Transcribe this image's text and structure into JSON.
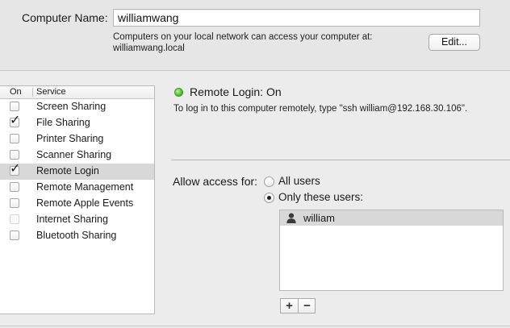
{
  "computer_name": {
    "label": "Computer Name:",
    "value": "williamwang",
    "info_line1": "Computers on your local network can access your computer at:",
    "info_line2": "williamwang.local",
    "edit_label": "Edit..."
  },
  "services": {
    "header_on": "On",
    "header_service": "Service",
    "items": [
      {
        "label": "Screen Sharing",
        "checked": false,
        "selected": false
      },
      {
        "label": "File Sharing",
        "checked": true,
        "selected": false
      },
      {
        "label": "Printer Sharing",
        "checked": false,
        "selected": false
      },
      {
        "label": "Scanner Sharing",
        "checked": false,
        "selected": false
      },
      {
        "label": "Remote Login",
        "checked": true,
        "selected": true
      },
      {
        "label": "Remote Management",
        "checked": false,
        "selected": false
      },
      {
        "label": "Remote Apple Events",
        "checked": false,
        "selected": false
      },
      {
        "label": "Internet Sharing",
        "checked": false,
        "selected": false,
        "disabled": true
      },
      {
        "label": "Bluetooth Sharing",
        "checked": false,
        "selected": false
      }
    ]
  },
  "status": {
    "title": "Remote Login: On",
    "description": "To log in to this computer remotely, type \"ssh william@192.168.30.106\".",
    "indicator_color": "#43b520"
  },
  "access": {
    "label": "Allow access for:",
    "options": [
      {
        "label": "All users",
        "selected": false
      },
      {
        "label": "Only these users:",
        "selected": true
      }
    ],
    "users": [
      "william"
    ],
    "add_label": "+",
    "remove_label": "−"
  }
}
